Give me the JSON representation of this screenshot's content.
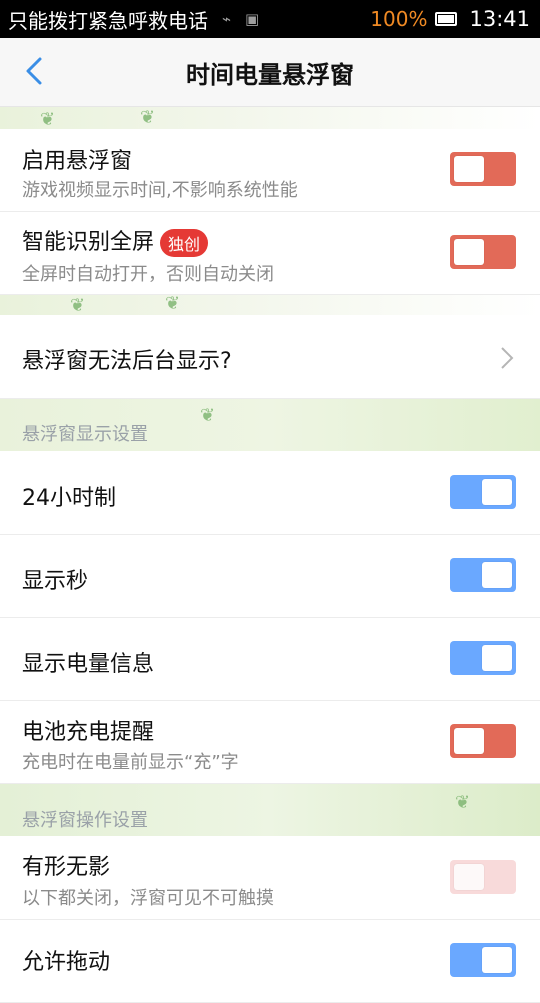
{
  "status_bar": {
    "carrier": "只能拨打紧急呼救电话",
    "usb_icon": "usb-icon",
    "android_icon": "android-debug-icon",
    "battery_percent": "100%",
    "time": "13:41",
    "battery_color": "#f08a24"
  },
  "header": {
    "title": "时间电量悬浮窗",
    "back_icon": "back-chevron-icon"
  },
  "rows": {
    "enable": {
      "label": "启用悬浮窗",
      "desc": "游戏视频显示时间,不影响系统性能",
      "toggle": "off"
    },
    "smart": {
      "label": "智能识别全屏",
      "badge": "独创",
      "desc": "全屏时自动打开，否则自动关闭",
      "toggle": "off"
    },
    "cannot_show": {
      "label": "悬浮窗无法后台显示?"
    },
    "h24": {
      "label": "24小时制",
      "toggle": "on"
    },
    "seconds": {
      "label": "显示秒",
      "toggle": "on"
    },
    "battery_info": {
      "label": "显示电量信息",
      "toggle": "on"
    },
    "charge_remind": {
      "label": "电池充电提醒",
      "desc": "充电时在电量前显示“充”字",
      "toggle": "off"
    },
    "ghost": {
      "label": "有形无影",
      "desc": "以下都关闭，浮窗可见不可触摸",
      "toggle": "off-disabled"
    },
    "allow_drag": {
      "label": "允许拖动",
      "toggle": "on"
    }
  },
  "sections": {
    "display": "悬浮窗显示设置",
    "operation": "悬浮窗操作设置"
  },
  "colors": {
    "toggle_off": "#e26a58",
    "toggle_on": "#6aa8ff",
    "badge": "#e53935"
  }
}
